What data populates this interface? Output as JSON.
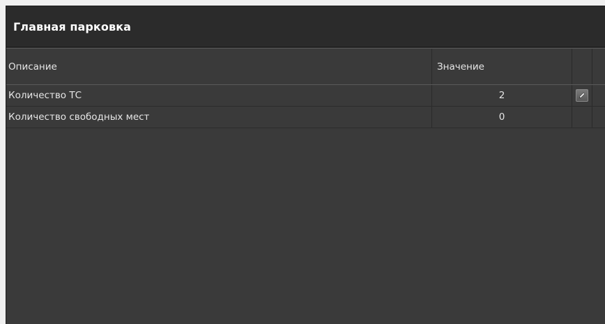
{
  "panel": {
    "title": "Главная парковка"
  },
  "table": {
    "columns": {
      "description": "Описание",
      "value": "Значение"
    },
    "rows": [
      {
        "description": "Количество ТС",
        "value": "2",
        "editable": true,
        "action_icon": "pencil-icon"
      },
      {
        "description": "Количество свободных мест",
        "value": "0",
        "editable": false
      }
    ]
  },
  "colors": {
    "panel_background": "#3a3a3a",
    "header_background": "#2b2b2b",
    "text": "#e6e6e6",
    "title_text": "#ffffff"
  }
}
